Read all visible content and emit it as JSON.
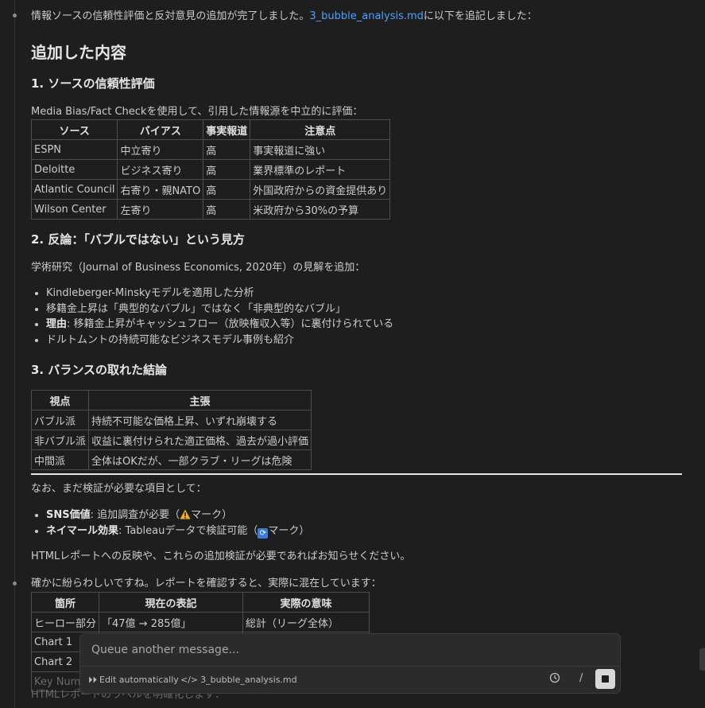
{
  "intro": {
    "before": "情報ソースの信頼性評価と反対意見の追加が完了しました。",
    "link": "3_bubble_analysis.md",
    "after": "に以下を追記しました："
  },
  "h_added": "追加した内容",
  "s1": {
    "title": "1. ソースの信頼性評価",
    "lead": "Media Bias/Fact Checkを使用して、引用した情報源を中立的に評価：",
    "headers": [
      "ソース",
      "バイアス",
      "事実報道",
      "注意点"
    ],
    "rows": [
      [
        "ESPN",
        "中立寄り",
        "高",
        "事実報道に強い"
      ],
      [
        "Deloitte",
        "ビジネス寄り",
        "高",
        "業界標準のレポート"
      ],
      [
        "Atlantic Council",
        "右寄り・親NATO",
        "高",
        "外国政府からの資金提供あり"
      ],
      [
        "Wilson Center",
        "左寄り",
        "高",
        "米政府から30%の予算"
      ]
    ]
  },
  "s2": {
    "title": "2. 反論：「バブルではない」という見方",
    "lead": "学術研究（Journal of Business Economics, 2020年）の見解を追加：",
    "items": [
      {
        "bold": "",
        "text": "Kindleberger-Minskyモデルを適用した分析"
      },
      {
        "bold": "",
        "text": "移籍金上昇は「典型的なバブル」ではなく「非典型的なバブル」"
      },
      {
        "bold": "理由",
        "text": ": 移籍金上昇がキャッシュフロー（放映権収入等）に裏付けられている"
      },
      {
        "bold": "",
        "text": "ドルトムントの持続可能なビジネスモデル事例も紹介"
      }
    ]
  },
  "s3": {
    "title": "3. バランスの取れた結論",
    "headers": [
      "視点",
      "主張"
    ],
    "rows": [
      [
        "バブル派",
        "持続不可能な価格上昇、いずれ崩壊する"
      ],
      [
        "非バブル派",
        "収益に裏付けられた適正価格、過去が過小評価"
      ],
      [
        "中間派",
        "全体はOKだが、一部クラブ・リーグは危険"
      ]
    ]
  },
  "note_lead": "なお、まだ検証が必要な項目として：",
  "notes": [
    {
      "bold": "SNS価値",
      "before": ": 追加調査が必要（",
      "icon": "warning-icon",
      "after": "マーク）"
    },
    {
      "bold": "ネイマール効果",
      "before": ": Tableauデータで検証可能（",
      "icon": "sync-icon",
      "after": "マーク）"
    }
  ],
  "closing": "HTMLレポートへの反映や、これらの追加検証が必要であればお知らせください。",
  "msg2": {
    "text": "確かに紛らわしいですね。レポートを確認すると、実際に混在しています：",
    "headers": [
      "箇所",
      "現在の表記",
      "実際の意味"
    ],
    "rows": [
      [
        "ヒーロー部分",
        "「47億 → 285億」",
        "総計（リーグ全体）"
      ],
      [
        "Chart 1",
        "",
        ""
      ],
      [
        "Chart 2",
        "",
        ""
      ],
      [
        "Key Numb",
        "",
        ""
      ]
    ],
    "faded": "HTMLレポートのラベルを明確化します："
  },
  "queue": {
    "placeholder": "Queue another message...",
    "edit_label": "Edit automatically",
    "file_label": "3_bubble_analysis.md",
    "slash": "/"
  },
  "colors": {
    "accent": "#4aa3ff",
    "background": "#1e1e1e",
    "text": "#cccccc"
  }
}
